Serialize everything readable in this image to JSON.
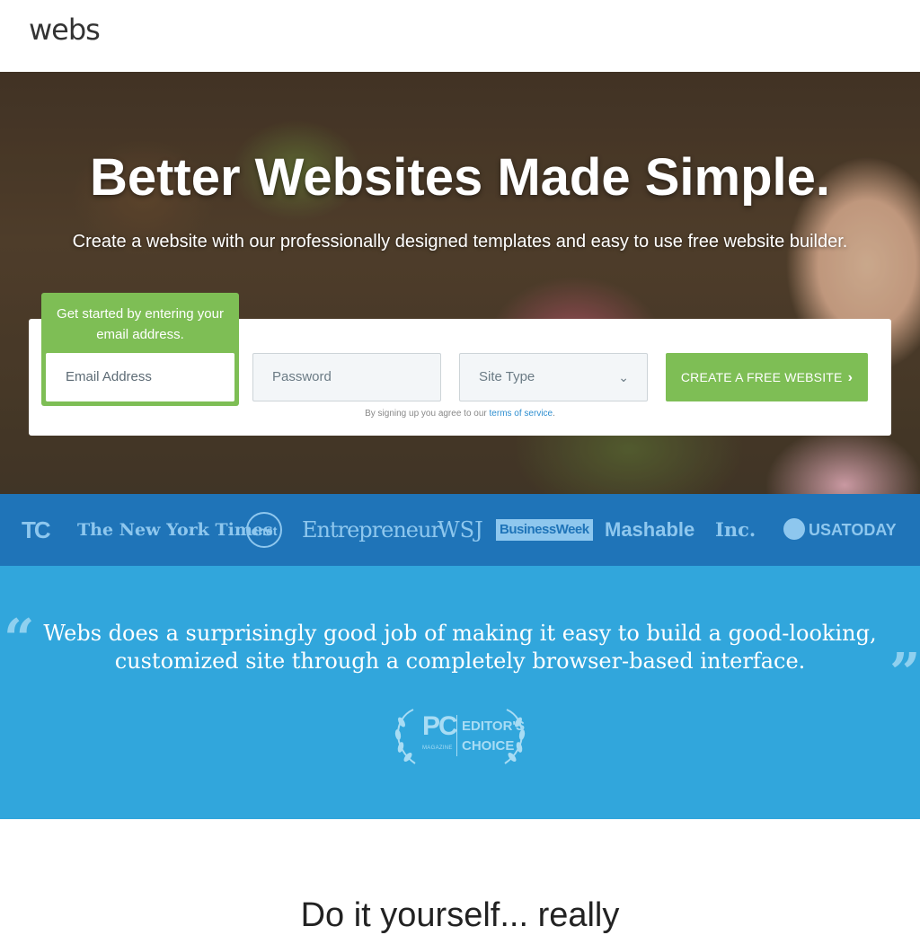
{
  "header": {
    "logo": "webs"
  },
  "hero": {
    "title": "Better Websites Made Simple.",
    "subtitle": "Create a website with our professionally designed templates and easy to use free website builder."
  },
  "signup": {
    "tip": "Get started by entering your email address.",
    "email_placeholder": "Email Address",
    "password_placeholder": "Password",
    "site_type": "Site Type",
    "cta_label": "CREATE A FREE WEBSITE",
    "terms_prefix": "By signing up you agree to our ",
    "terms_link": "terms of service",
    "terms_suffix": "."
  },
  "press": {
    "logos": [
      "TC",
      "The New York Times",
      "cnet",
      "Entrepreneur",
      "WSJ",
      "BusinessWeek",
      "Mashable",
      "Inc.",
      "USATODAY"
    ]
  },
  "quote": {
    "text": "Webs does a surprisingly good job of making it easy to build a good-looking, customized site through a completely browser-based interface.",
    "award_pc": "PC",
    "award_magazine": "MAGAZINE",
    "award_line1": "EDITOR'S",
    "award_line2": "CHOICE"
  },
  "section2": {
    "heading": "Do it yourself... really"
  },
  "colors": {
    "accent_green": "#7ebe55",
    "press_blue": "#1f74b8",
    "quote_blue": "#31a6dc"
  }
}
